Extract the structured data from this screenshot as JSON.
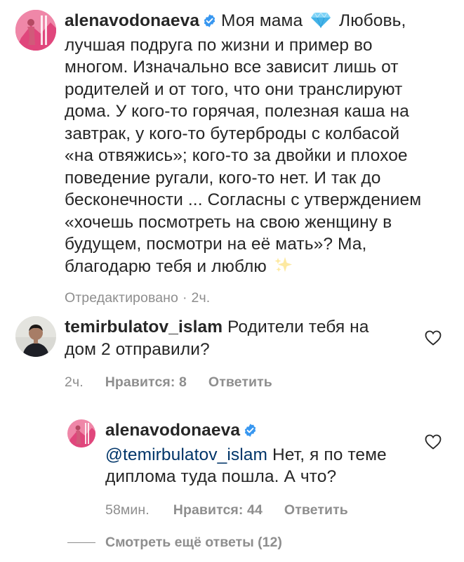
{
  "comments": {
    "main": {
      "username": "alenavodonaeva",
      "text_line1": "Моя мама",
      "text_line1_after": "Любовь,",
      "text_rest": [
        "лучшая подруга по жизни и пример во",
        "многом. Изначально все зависит лишь от",
        "родителей и от того, что они транслируют",
        "дома. У кого-то горячая, полезная каша на",
        "завтрак, у кого-то бутерброды с колбасой",
        "«на отвяжись»; кого-то за двойки и плохое",
        "поведение ругали, кого-то нет. И так до",
        "бесконечности ... Согласны с утверждением",
        "«хочешь посмотреть на свою женщину в",
        "будущем, посмотри на её мать»? Ма,",
        "благодарю тебя и люблю"
      ],
      "edited_label": "Отредактировано",
      "separator": "·",
      "time": "2ч."
    },
    "reply1": {
      "username": "temirbulatov_islam",
      "text_first": "Родители тебя на",
      "text_second": "дом 2 отправили?",
      "time": "2ч.",
      "likes_label": "Нравится: 8",
      "reply_label": "Ответить"
    },
    "reply2": {
      "username": "alenavodonaeva",
      "mention": "@temirbulatov_islam",
      "text_first": "Нет, я по теме",
      "text_second": "диплома туда пошла. А что?",
      "time": "58мин.",
      "likes_label": "Нравится: 44",
      "reply_label": "Ответить"
    }
  },
  "view_more_replies": "Смотреть ещё ответы (12)",
  "colors": {
    "text": "#262626",
    "meta": "#8e8e8e",
    "verified": "#3897f0",
    "mention": "#003569",
    "pink_avatar": "#e8799a"
  },
  "icons": {
    "verified": "verified-badge-icon",
    "diamond": "gem-emoji-icon",
    "sparkles": "sparkles-emoji-icon",
    "heart": "heart-outline-icon"
  }
}
